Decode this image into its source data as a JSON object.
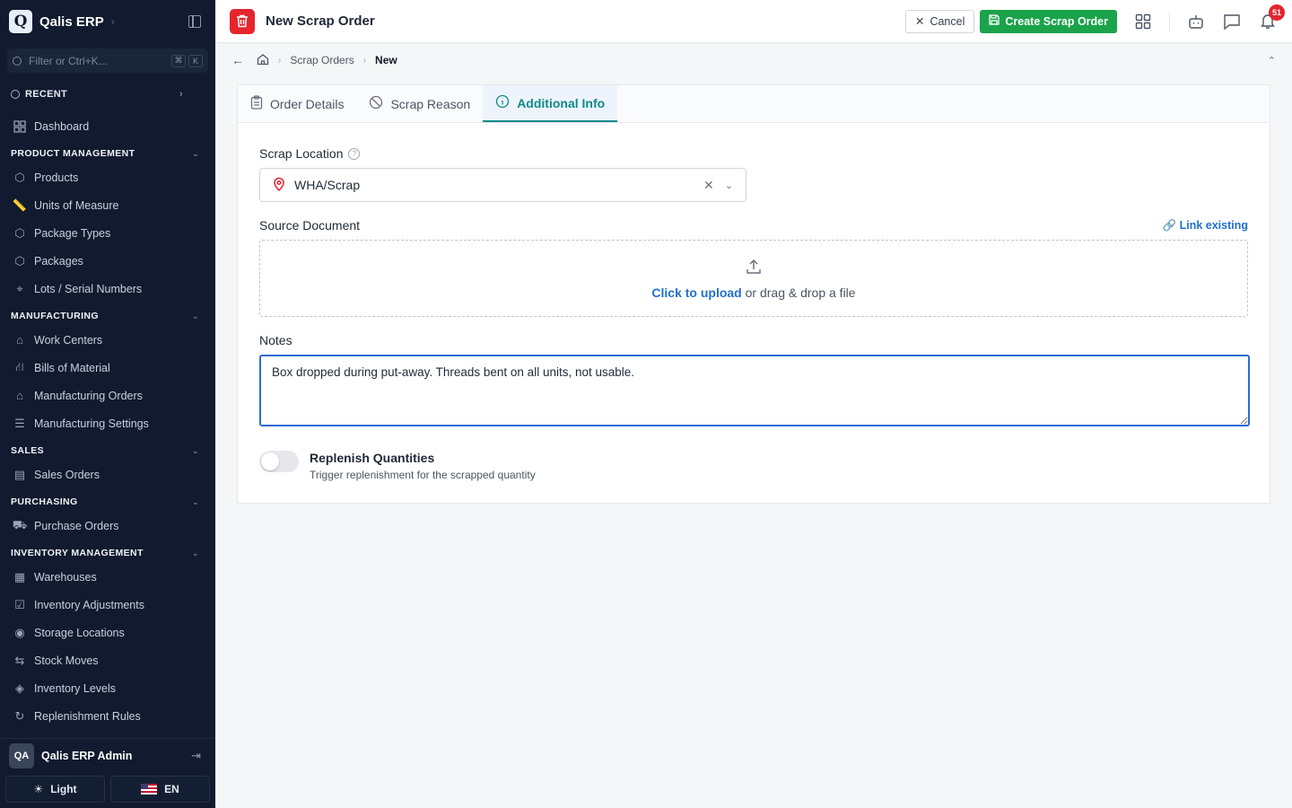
{
  "app": {
    "logo_letter": "Q",
    "name": "Qalis ERP"
  },
  "filter": {
    "placeholder": "Filter or Ctrl+K...",
    "kbd1": "⌘",
    "kbd2": "K"
  },
  "recent_label": "RECENT",
  "nav": {
    "dashboard": "Dashboard",
    "sections": [
      {
        "title": "PRODUCT MANAGEMENT",
        "items": [
          "Products",
          "Units of Measure",
          "Package Types",
          "Packages",
          "Lots / Serial Numbers"
        ]
      },
      {
        "title": "MANUFACTURING",
        "items": [
          "Work Centers",
          "Bills of Material",
          "Manufacturing Orders",
          "Manufacturing Settings"
        ]
      },
      {
        "title": "SALES",
        "items": [
          "Sales Orders"
        ]
      },
      {
        "title": "PURCHASING",
        "items": [
          "Purchase Orders"
        ]
      },
      {
        "title": "INVENTORY MANAGEMENT",
        "items": [
          "Warehouses",
          "Inventory Adjustments",
          "Storage Locations",
          "Stock Moves",
          "Inventory Levels",
          "Replenishment Rules"
        ]
      }
    ]
  },
  "user": {
    "initials": "QA",
    "name": "Qalis ERP Admin"
  },
  "footer": {
    "theme_label": "Light",
    "lang_label": "EN"
  },
  "header": {
    "title": "New Scrap Order",
    "cancel_label": "Cancel",
    "create_label": "Create Scrap Order",
    "notification_count": "51"
  },
  "breadcrumb": {
    "parent": "Scrap Orders",
    "current": "New"
  },
  "tabs": [
    {
      "label": "Order Details",
      "icon": "clipboard-icon"
    },
    {
      "label": "Scrap Reason",
      "icon": "ban-icon"
    },
    {
      "label": "Additional Info",
      "icon": "info-icon"
    }
  ],
  "form": {
    "scrap_location_label": "Scrap Location",
    "scrap_location_value": "WHA/Scrap",
    "source_document_label": "Source Document",
    "link_existing": "Link existing",
    "upload_link": "Click to upload",
    "upload_rest": " or drag & drop a file",
    "notes_label": "Notes",
    "notes_value": "Box dropped during put-away. Threads bent on all units, not usable.",
    "replenish_title": "Replenish Quantities",
    "replenish_desc": "Trigger replenishment for the scrapped quantity"
  },
  "colors": {
    "accent": "#0e8a8a",
    "create": "#1aa34a",
    "brand_red": "#e5242e",
    "sidebar": "#111a2e",
    "link": "#1f6fd1"
  }
}
